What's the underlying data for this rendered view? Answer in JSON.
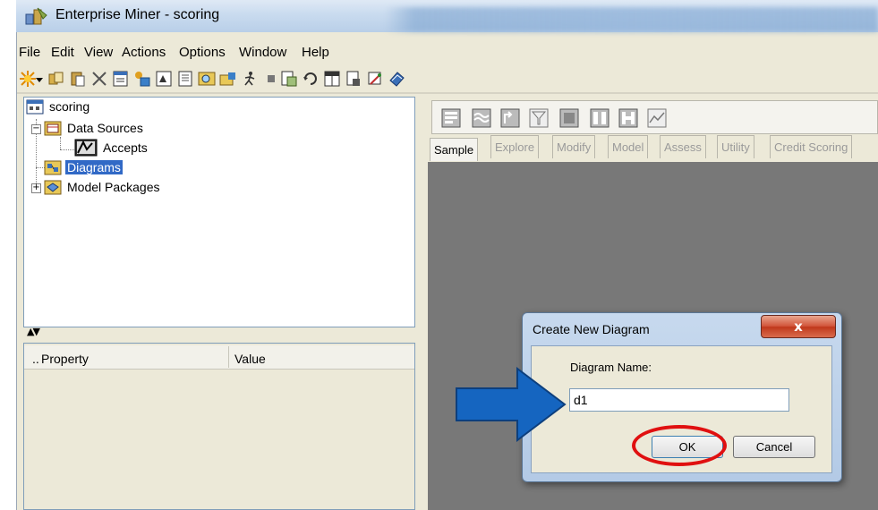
{
  "window": {
    "title": "Enterprise Miner - scoring"
  },
  "menu": [
    "File",
    "Edit",
    "View",
    "Actions",
    "Options",
    "Window",
    "Help"
  ],
  "toolbar_icons": [
    "new-icon",
    "dropdown-icon",
    "copy-icon",
    "paste-icon",
    "delete-icon",
    "notes-icon",
    "data-icon",
    "import-icon",
    "library-icon",
    "explore-icon",
    "open-icon",
    "run-icon",
    "stop-icon",
    "results-icon",
    "refresh-icon",
    "grid-icon",
    "report-icon",
    "wand-icon",
    "help-book-icon"
  ],
  "tree": {
    "root": "scoring",
    "data_sources": "Data Sources",
    "accepts": "Accepts",
    "diagrams": "Diagrams",
    "model_packages": "Model Packages"
  },
  "properties": {
    "col_dots": "..",
    "col_property": "Property",
    "col_value": "Value"
  },
  "tabs": [
    "Sample",
    "Explore",
    "Modify",
    "Model",
    "Assess",
    "Utility",
    "Credit Scoring"
  ],
  "active_tab": "Sample",
  "dialog": {
    "title": "Create New Diagram",
    "close": "x",
    "label": "Diagram Name:",
    "value": "d1",
    "ok": "OK",
    "cancel": "Cancel"
  },
  "colors": {
    "annotation_arrow": "#1565c0",
    "annotation_circle": "#e01010",
    "selection": "#3169c6",
    "canvas": "#787878"
  }
}
